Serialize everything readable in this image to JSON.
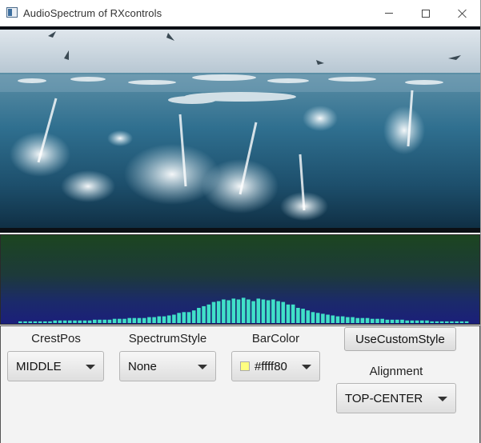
{
  "window": {
    "title": "AudioSpectrum of RXcontrols"
  },
  "icons": {
    "app": "app-window-icon",
    "minimize": "minimize-icon",
    "maximize": "maximize-icon",
    "close": "close-icon",
    "dropdown": "chevron-down-icon"
  },
  "video": {
    "scene": "ocean-splash-birds"
  },
  "spectrum": {
    "bar_color": "#40e0c8",
    "bar_levels": [
      0.02,
      0.02,
      0.02,
      0.02,
      0.02,
      0.02,
      0.02,
      0.03,
      0.03,
      0.03,
      0.03,
      0.03,
      0.03,
      0.03,
      0.03,
      0.04,
      0.04,
      0.04,
      0.04,
      0.05,
      0.05,
      0.05,
      0.06,
      0.06,
      0.06,
      0.06,
      0.07,
      0.07,
      0.08,
      0.08,
      0.09,
      0.1,
      0.12,
      0.13,
      0.13,
      0.15,
      0.18,
      0.2,
      0.22,
      0.25,
      0.26,
      0.28,
      0.27,
      0.29,
      0.28,
      0.3,
      0.28,
      0.26,
      0.29,
      0.28,
      0.27,
      0.28,
      0.26,
      0.25,
      0.22,
      0.22,
      0.18,
      0.17,
      0.15,
      0.13,
      0.12,
      0.11,
      0.1,
      0.09,
      0.08,
      0.08,
      0.07,
      0.07,
      0.06,
      0.06,
      0.06,
      0.05,
      0.05,
      0.05,
      0.04,
      0.04,
      0.04,
      0.04,
      0.03,
      0.03,
      0.03,
      0.03,
      0.03,
      0.02,
      0.02,
      0.02,
      0.02,
      0.02,
      0.02,
      0.02,
      0.02
    ]
  },
  "controls": {
    "crest_pos": {
      "label": "CrestPos",
      "value": "MIDDLE"
    },
    "spectrum_style": {
      "label": "SpectrumStyle",
      "value": "None"
    },
    "bar_color": {
      "label": "BarColor",
      "value": "#ffff80",
      "swatch": "#ffff80"
    },
    "use_custom_style": {
      "label": "UseCustomStyle"
    },
    "alignment": {
      "label": "Alignment",
      "value": "TOP-CENTER"
    }
  }
}
